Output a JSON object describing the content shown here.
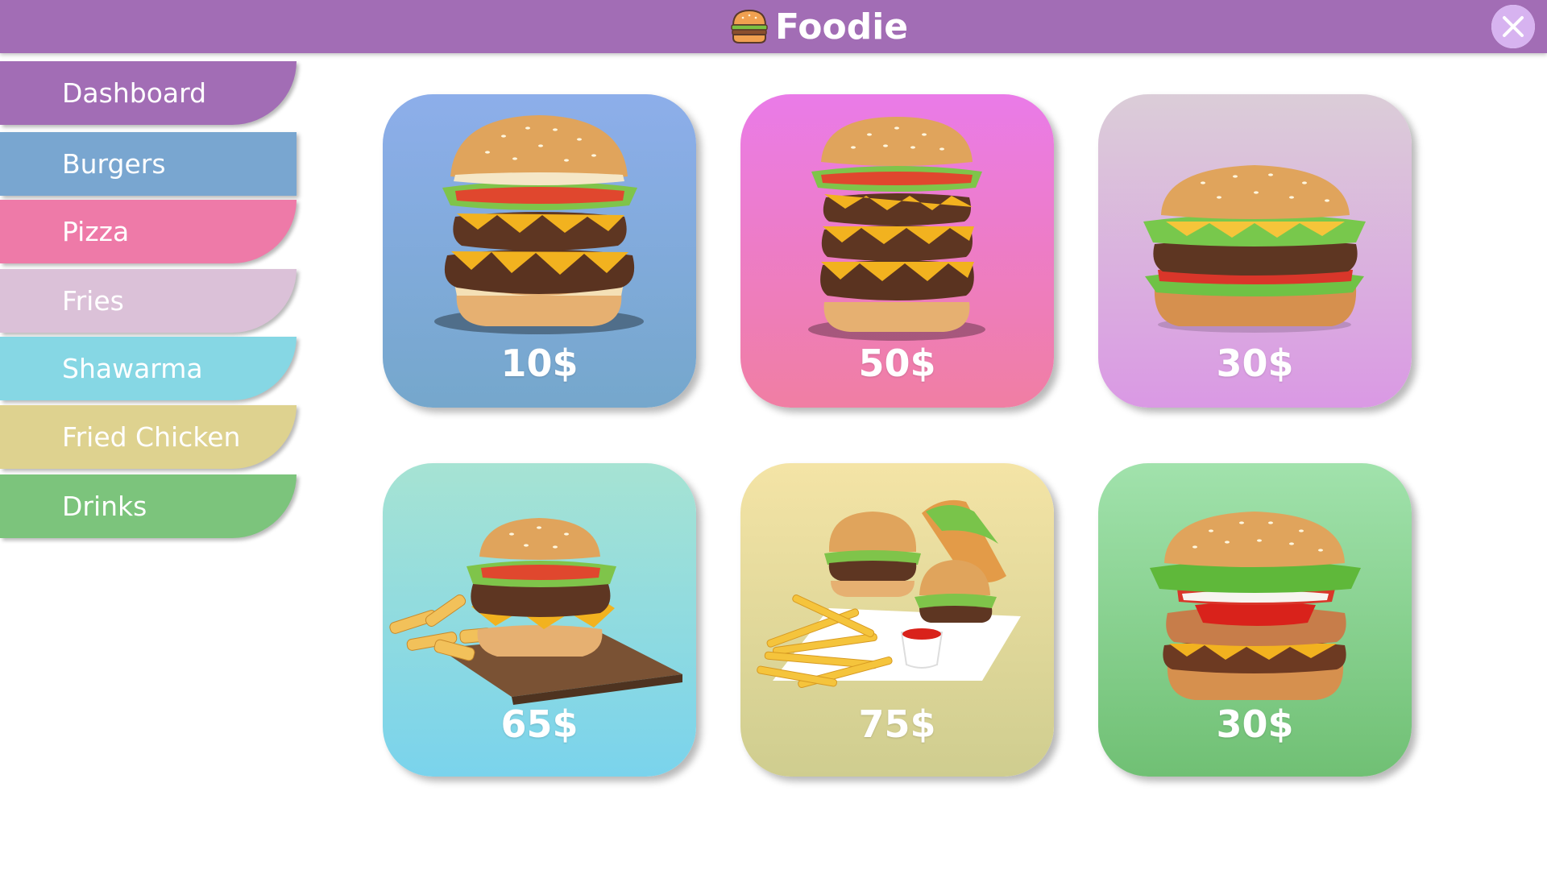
{
  "app": {
    "title": "Foodie",
    "accent_color": "#a26db5",
    "logo_icon": "burger-icon",
    "close_icon": "close-icon"
  },
  "sidebar": {
    "items": [
      {
        "label": "Dashboard",
        "color": "#a26db5"
      },
      {
        "label": "Burgers",
        "color": "#79a6d0"
      },
      {
        "label": "Pizza",
        "color": "#ee7aa8"
      },
      {
        "label": "Fries",
        "color": "#dbc1d8"
      },
      {
        "label": "Shawarma",
        "color": "#86d7e4"
      },
      {
        "label": "Fried Chicken",
        "color": "#ded28f"
      },
      {
        "label": "Drinks",
        "color": "#7cc47c"
      }
    ]
  },
  "products": [
    {
      "price": "10$",
      "item": "double-cheeseburger",
      "gradient": [
        "#8daeea",
        "#75a7cc"
      ]
    },
    {
      "price": "50$",
      "item": "triple-cheeseburger",
      "gradient": [
        "#ea7be8",
        "#f07ea3"
      ]
    },
    {
      "price": "30$",
      "item": "classic-burger",
      "gradient": [
        "#dbcdd8",
        "#da99e4"
      ]
    },
    {
      "price": "65$",
      "item": "burger-with-fries",
      "gradient": [
        "#a6e3d3",
        "#7ad3ec"
      ]
    },
    {
      "price": "75$",
      "item": "burger-combo",
      "gradient": [
        "#f4e4a6",
        "#cfcd8f"
      ]
    },
    {
      "price": "30$",
      "item": "deluxe-burger",
      "gradient": [
        "#a1e2ac",
        "#70c074"
      ]
    }
  ]
}
